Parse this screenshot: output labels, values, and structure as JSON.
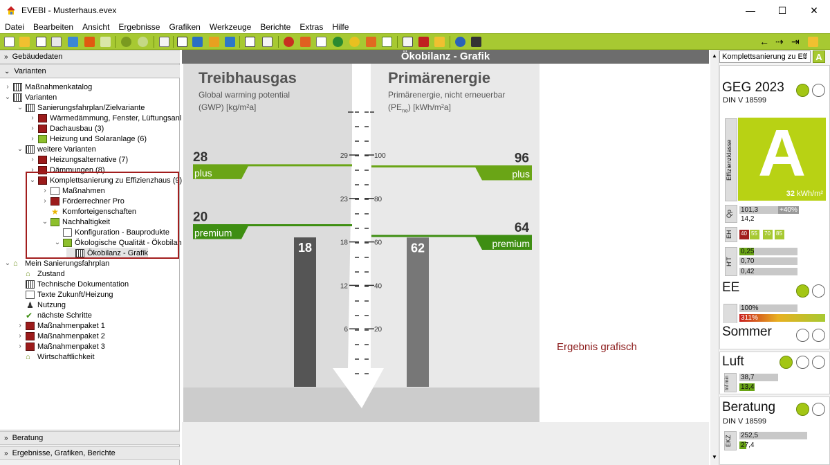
{
  "window": {
    "app": "EVEBI",
    "title": "EVEBI  - Musterhaus.evex",
    "min": "—",
    "max": "☐",
    "close": "✕"
  },
  "menu": [
    "Datei",
    "Bearbeiten",
    "Ansicht",
    "Ergebnisse",
    "Grafiken",
    "Werkzeuge",
    "Berichte",
    "Extras",
    "Hilfe"
  ],
  "left": {
    "gebaeudedaten": "Gebäudedaten",
    "varianten": "Varianten",
    "beratung": "Beratung",
    "ergebnisse": "Ergebnisse, Grafiken, Berichte",
    "tree": [
      {
        "label": "Maßnahmenkatalog",
        "icon": "catalog-icon",
        "arrow": "›",
        "indent": 0
      },
      {
        "label": "Varianten",
        "icon": "calendar-icon",
        "arrow": "⌄",
        "indent": 0
      },
      {
        "label": "Sanierungsfahrplan/Zielvariante",
        "icon": "calendar-icon",
        "arrow": "⌄",
        "indent": 1
      },
      {
        "label": "Wärmedämmung, Fenster, Lüftungsanl",
        "icon": "cube-icon",
        "arrow": "›",
        "indent": 2
      },
      {
        "label": "Dachausbau (3)",
        "icon": "cube-icon",
        "arrow": "›",
        "indent": 2
      },
      {
        "label": "Heizung und Solaranlage (6)",
        "icon": "green-cube-icon",
        "arrow": "›",
        "indent": 2
      },
      {
        "label": "weitere Varianten",
        "icon": "calendar-icon",
        "arrow": "⌄",
        "indent": 1
      },
      {
        "label": "Heizungsalternative (7)",
        "icon": "cube-icon",
        "arrow": "›",
        "indent": 2
      },
      {
        "label": "Dämmungen (8)",
        "icon": "cube-icon",
        "arrow": "›",
        "indent": 2
      },
      {
        "label": "Komplettsanierung zu Effizienzhaus (9)",
        "icon": "cube-icon",
        "arrow": "⌄",
        "indent": 2
      },
      {
        "label": "Maßnahmen",
        "icon": "checklist-icon",
        "arrow": "›",
        "indent": 3
      },
      {
        "label": "Förderrechner Pro",
        "icon": "calculator-icon",
        "arrow": "›",
        "indent": 3
      },
      {
        "label": "Komforteigenschaften",
        "icon": "star-icon",
        "arrow": "",
        "indent": 3
      },
      {
        "label": "Nachhaltigkeit",
        "icon": "recycle-icon",
        "arrow": "⌄",
        "indent": 3
      },
      {
        "label": "Konfiguration - Bauprodukte",
        "icon": "config-icon",
        "arrow": "",
        "indent": 4
      },
      {
        "label": "Ökologische Qualität - Ökobilanz",
        "icon": "tree-icon",
        "arrow": "⌄",
        "indent": 4
      },
      {
        "label": "Ökobilanz - Grafik",
        "icon": "chart-icon",
        "arrow": "",
        "indent": 5,
        "selected": true
      },
      {
        "label": "Mein Sanierungsfahrplan",
        "icon": "house-icon",
        "arrow": "⌄",
        "indent": 0
      },
      {
        "label": "Zustand",
        "icon": "house-icon",
        "arrow": "",
        "indent": 1
      },
      {
        "label": "Technische Dokumentation",
        "icon": "calendar-icon",
        "arrow": "",
        "indent": 1
      },
      {
        "label": "Texte Zukunft/Heizung",
        "icon": "doc-icon",
        "arrow": "",
        "indent": 1
      },
      {
        "label": "Nutzung",
        "icon": "person-icon",
        "arrow": "",
        "indent": 1
      },
      {
        "label": "nächste Schritte",
        "icon": "check-icon",
        "arrow": "",
        "indent": 1
      },
      {
        "label": "Maßnahmenpaket 1",
        "icon": "cube-icon",
        "arrow": "›",
        "indent": 1
      },
      {
        "label": "Maßnahmenpaket 2",
        "icon": "cube-icon",
        "arrow": "›",
        "indent": 1
      },
      {
        "label": "Maßnahmenpaket 3",
        "icon": "cube-icon",
        "arrow": "›",
        "indent": 1
      },
      {
        "label": "Wirtschaftlichkeit",
        "icon": "money-icon",
        "arrow": "",
        "indent": 1
      }
    ]
  },
  "center": {
    "header": "Ökobilanz - Grafik",
    "left_title": "Treibhausgas",
    "left_sub1": "Global warming potential",
    "left_sub2": "(GWP) [kg/m²a]",
    "right_title": "Primärenergie",
    "right_sub1": "Primärenergie, nicht erneuerbar",
    "right_sub2_a": "(PE",
    "right_sub2_sub": "ne",
    "right_sub2_b": ") [kWh/m²a]",
    "plus_left_value": "28",
    "plus_label": "plus",
    "plus_right_value": "96",
    "premium_left_value": "20",
    "premium_label": "premium",
    "premium_right_value": "64",
    "ergebnis": "Ergebnis grafisch",
    "chart_data": {
      "type": "bar",
      "series": [
        {
          "name": "Treibhausgas",
          "values": [
            18
          ]
        },
        {
          "name": "Primärenergie",
          "values": [
            62
          ]
        }
      ],
      "left_axis_ticks": [
        "29",
        "23",
        "18",
        "12",
        "6"
      ],
      "right_axis_ticks": [
        "100",
        "80",
        "60",
        "40",
        "20"
      ],
      "left_ylim": [
        0,
        29
      ],
      "right_ylim": [
        0,
        100
      ],
      "thresholds": [
        {
          "label": "plus",
          "gwp": 28,
          "pe": 96
        },
        {
          "label": "premium",
          "gwp": 20,
          "pe": 64
        }
      ]
    }
  },
  "right": {
    "dropdown": "Komplettsanierung zu Eff",
    "badge": "A",
    "geg": "GEG 2023",
    "din": "DIN V 18599",
    "effizienz_label": "Effizienzklasse",
    "effizienz_class": "A",
    "effizienz_value": "32",
    "effizienz_unit": "kWh/m²",
    "qp_label": "Qp",
    "qp1": "101,3",
    "qp_pct": "+40%",
    "qp2": "14,2",
    "eh_label": "EH",
    "eh": [
      "40",
      "55",
      "70",
      "85"
    ],
    "ht_label": "H'T",
    "ht": [
      "0,25",
      "0,70",
      "0,42"
    ],
    "ht_fill": 0.25,
    "ee": "EE",
    "ee1": "100%",
    "ee2": "311%",
    "sommer": "Sommer",
    "luft": "Luft",
    "inf_label": "Inf min",
    "inf1": "38,7",
    "inf2": "13,4",
    "beratung": "Beratung",
    "din2": "DIN V 18599",
    "ekz_label": "EKZ",
    "ekz1": "252,5",
    "ekz2": "27,4",
    "colors": {
      "accent": "#a7c932",
      "green": "#6aa516",
      "darkgreen": "#3e8e12",
      "red": "#a21d1d",
      "efficiency": "#b8d214"
    }
  }
}
